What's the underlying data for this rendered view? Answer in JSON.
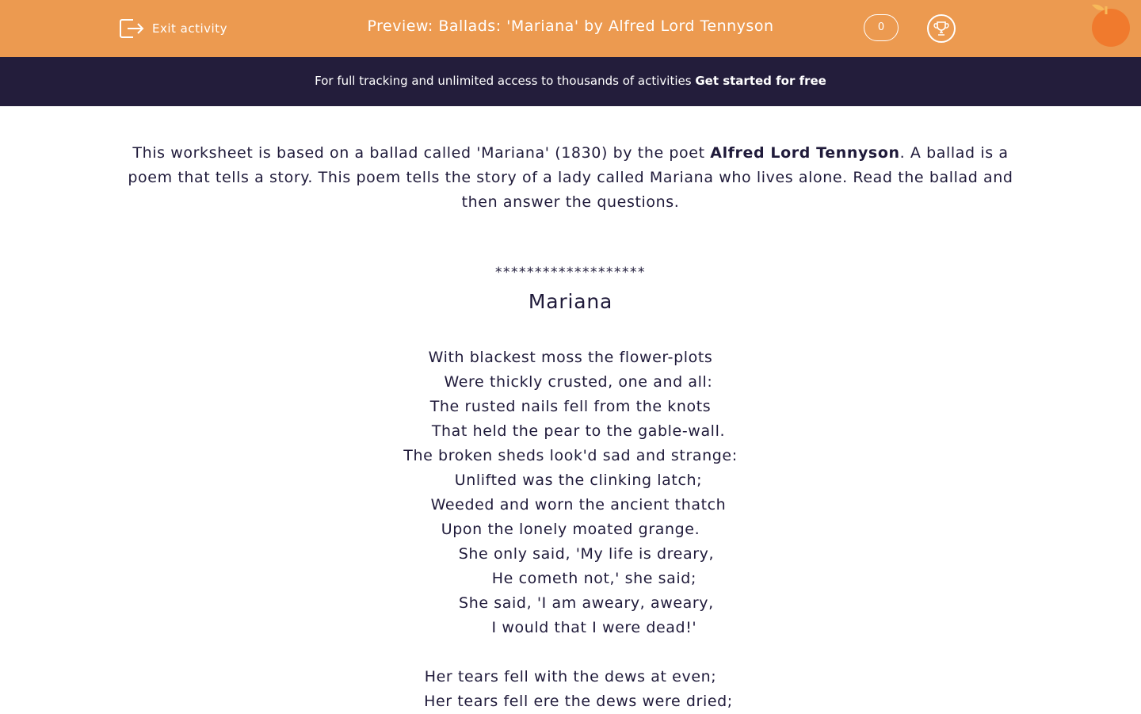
{
  "header": {
    "exit_label": "Exit activity",
    "title": "Preview: Ballads: 'Mariana' by Alfred Lord Tennyson",
    "score": "0",
    "colors": {
      "bar": "#ec9a50",
      "banner": "#231d3b",
      "text": "#1f1a3a"
    },
    "icons": [
      "exit-icon",
      "trophy-icon",
      "orange-logo-icon"
    ]
  },
  "banner": {
    "text": "For full tracking and unlimited access to thousands of activities ",
    "link": "Get started for free"
  },
  "intro": {
    "part1": "This worksheet is based on a ballad called 'Mariana' (1830) by the poet ",
    "bold": "Alfred Lord Tennyson",
    "part2": ". A ballad is a poem that tells a story. This poem tells the story of a lady called Mariana who lives alone. Read the ballad and then answer the questions."
  },
  "poem": {
    "separator": "*******************",
    "title": "Mariana",
    "stanza1": [
      "With blackest moss the flower-plots",
      "   Were thickly crusted, one and all:",
      "The rusted nails fell from the knots",
      "   That held the pear to the gable-wall.",
      "The broken sheds look'd sad and strange:",
      "   Unlifted was the clinking latch;",
      "   Weeded and worn the ancient thatch",
      "Upon the lonely moated grange.",
      "      She only said, 'My life is dreary,",
      "         He cometh not,' she said;",
      "      She said, 'I am aweary, aweary,",
      "         I would that I were dead!'"
    ],
    "stanza2": [
      "Her tears fell with the dews at even;",
      "   Her tears fell ere the dews were dried;"
    ]
  }
}
